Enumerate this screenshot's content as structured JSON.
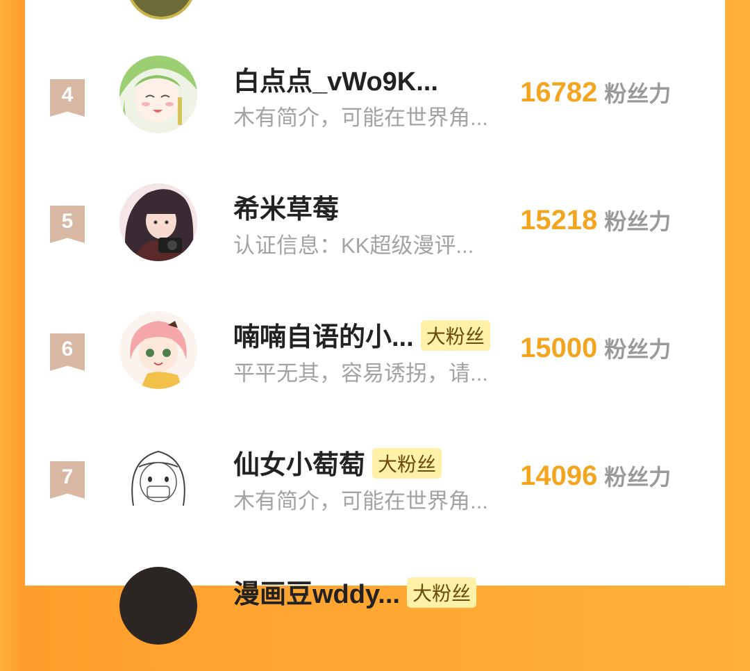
{
  "colors": {
    "accent": "#f4a51f",
    "badge_bg": "#fff1a8",
    "rank_bg": "#d9b8a3",
    "frame": "#ffb13a"
  },
  "fans_label": "粉丝力",
  "rows": [
    {
      "rank": "4",
      "name": "白点点_vWo9K...",
      "badge": "",
      "desc": "木有简介，可能在世界角...",
      "score": "16782",
      "avatar": "green-haired-girl-avatar"
    },
    {
      "rank": "5",
      "name": "希米草莓",
      "badge": "",
      "desc": "认证信息：KK超级漫评...",
      "score": "15218",
      "avatar": "dark-haired-girl-camera-avatar"
    },
    {
      "rank": "6",
      "name": "喃喃自语的小...",
      "badge": "大粉丝",
      "desc": "平平无其，容易诱拐，请...",
      "score": "15000",
      "avatar": "pink-haired-girl-avatar"
    },
    {
      "rank": "7",
      "name": "仙女小萄萄",
      "badge": "大粉丝",
      "desc": "木有简介，可能在世界角...",
      "score": "14096",
      "avatar": "sketch-girl-avatar"
    },
    {
      "rank": "",
      "name": "漫画豆wddy...",
      "badge": "大粉丝",
      "desc": "",
      "score": "",
      "avatar": "partial-avatar"
    }
  ]
}
